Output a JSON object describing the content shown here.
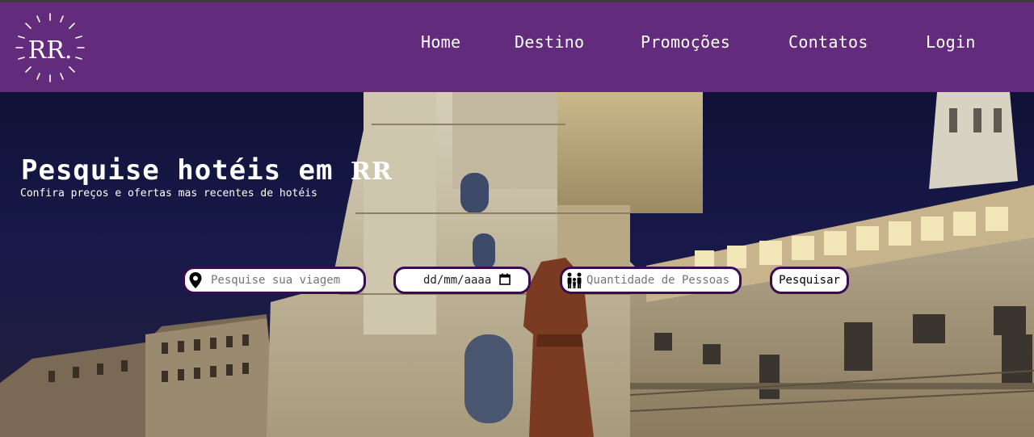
{
  "brand": {
    "logo_text": "RR."
  },
  "nav": {
    "items": [
      "Home",
      "Destino",
      "Promoções",
      "Contatos",
      "Login"
    ]
  },
  "hero": {
    "title": "Pesquise hotéis em",
    "title_brand": "RR",
    "subtitle": "Confira preços e ofertas mas recentes de hotéis"
  },
  "search": {
    "destination_placeholder": "Pesquise sua viagem",
    "date_value": "dd/mm/aaaa",
    "people_placeholder": "Quantidade de Pessoas",
    "submit_label": "Pesquisar"
  },
  "icons": {
    "destination": "map-pin-icon",
    "date": "calendar-icon",
    "people": "family-icon"
  },
  "colors": {
    "navbar": "#632b7b",
    "field_border": "#3a0b52",
    "sky": "#18194a"
  }
}
